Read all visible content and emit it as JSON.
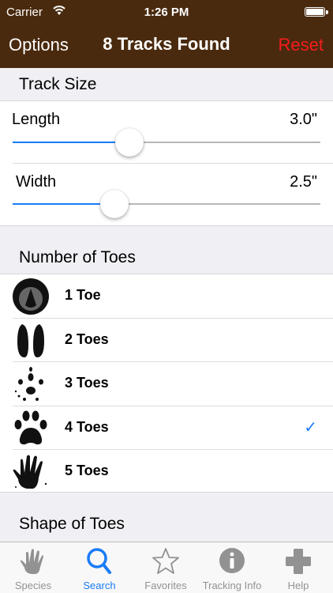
{
  "status_bar": {
    "carrier": "Carrier",
    "time": "1:26 PM"
  },
  "nav": {
    "left": "Options",
    "title": "8 Tracks Found",
    "right": "Reset"
  },
  "track_size": {
    "header": "Track Size",
    "length": {
      "label": "Length",
      "value": "3.0\"",
      "level": 0.38
    },
    "width": {
      "label": "Width",
      "value": "2.5\"",
      "level": 0.33
    }
  },
  "number_of_toes": {
    "header": "Number of Toes",
    "options": [
      {
        "label": "1 Toe",
        "icon": "hoof-icon",
        "selected": false
      },
      {
        "label": "2 Toes",
        "icon": "cloven-hoof-icon",
        "selected": false
      },
      {
        "label": "3 Toes",
        "icon": "bird-track-icon",
        "selected": false
      },
      {
        "label": "4 Toes",
        "icon": "paw-print-icon",
        "selected": true
      },
      {
        "label": "5 Toes",
        "icon": "hand-print-icon",
        "selected": false
      }
    ],
    "checkmark": "✓"
  },
  "shape_of_toes": {
    "header": "Shape of Toes"
  },
  "tabs": [
    {
      "label": "Species",
      "icon": "paw-hand-icon",
      "active": false
    },
    {
      "label": "Search",
      "icon": "search-icon",
      "active": true
    },
    {
      "label": "Favorites",
      "icon": "star-icon",
      "active": false
    },
    {
      "label": "Tracking Info",
      "icon": "info-icon",
      "active": false
    },
    {
      "label": "Help",
      "icon": "plus-icon",
      "active": false
    }
  ],
  "colors": {
    "nav_bg": "#4a2a0e",
    "reset": "#f41d1d",
    "accent": "#1a7cf5"
  }
}
